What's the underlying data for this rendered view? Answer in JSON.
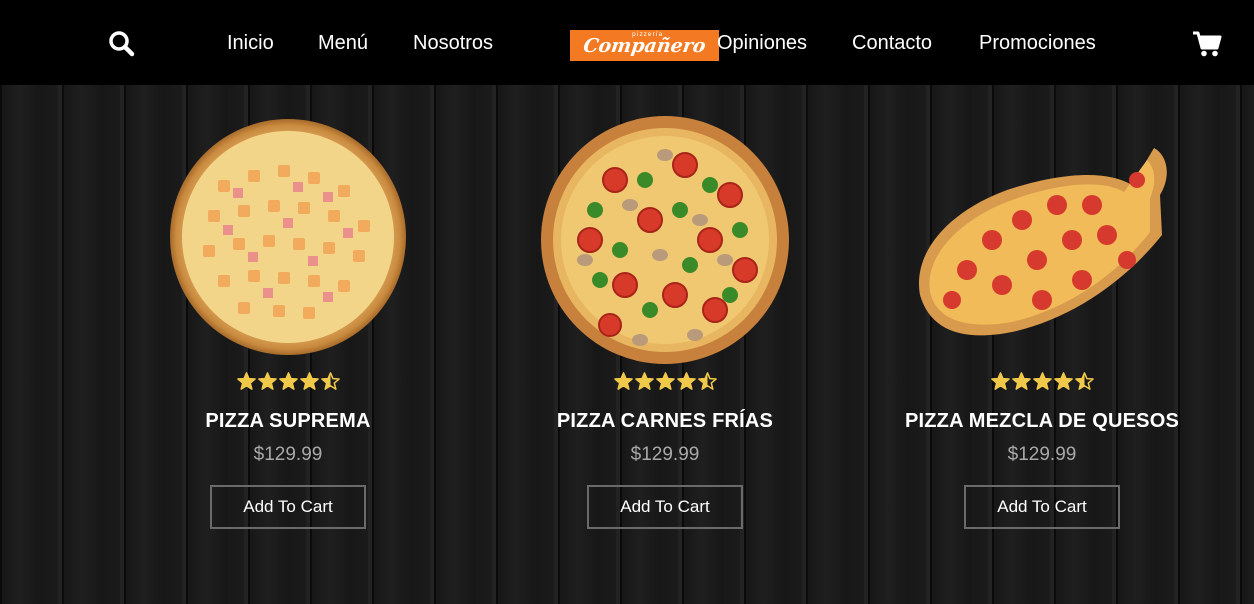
{
  "nav": {
    "search_icon": "search-icon",
    "links": [
      "Inicio",
      "Menú",
      "Nosotros",
      "Opiniones",
      "Contacto",
      "Promociones"
    ],
    "logo_text": "Compañero",
    "logo_small": "pizzería",
    "logo_color": "#f37a22",
    "cart_icon": "cart-icon"
  },
  "products": [
    {
      "name": "PIZZA SUPREMA",
      "price": "$129.99",
      "button": "Add To Cart",
      "rating": 4.5
    },
    {
      "name": "PIZZA CARNES FRÍAS",
      "price": "$129.99",
      "button": "Add To Cart",
      "rating": 4.5
    },
    {
      "name": "PIZZA MEZCLA DE QUESOS",
      "price": "$129.99",
      "button": "Add To Cart",
      "rating": 4.5
    }
  ],
  "colors": {
    "star": "#f0c94a",
    "price": "#a8a8a8",
    "background": "#1a1a1a",
    "navbar": "#000000"
  }
}
